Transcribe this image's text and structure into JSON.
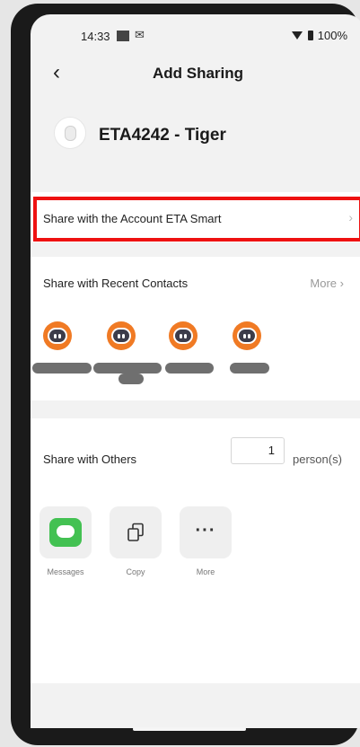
{
  "status_bar": {
    "time": "14:33",
    "battery": "100%",
    "icons": [
      "square-icon",
      "mail-icon",
      "wifi-icon",
      "battery-icon"
    ]
  },
  "header": {
    "back_icon": "chevron-left-icon",
    "title": "Add Sharing"
  },
  "device": {
    "name": "ETA4242 - Tiger",
    "icon": "robot-vacuum-icon"
  },
  "share_account": {
    "label": "Share with the Account ETA Smart",
    "chevron": "chevron-right-icon",
    "highlight_color": "#ee1111"
  },
  "recent_contacts": {
    "label": "Share with Recent Contacts",
    "more_label": "More",
    "contact_count": 4,
    "avatar_color": "#f07a24"
  },
  "share_others": {
    "label": "Share with Others",
    "quantity": "1",
    "unit": "person(s)"
  },
  "share_apps": [
    {
      "label": "Messages",
      "icon": "messages-icon",
      "color": "#43c152"
    },
    {
      "label": "Copy",
      "icon": "copy-icon"
    },
    {
      "label": "More",
      "icon": "more-icon"
    }
  ]
}
